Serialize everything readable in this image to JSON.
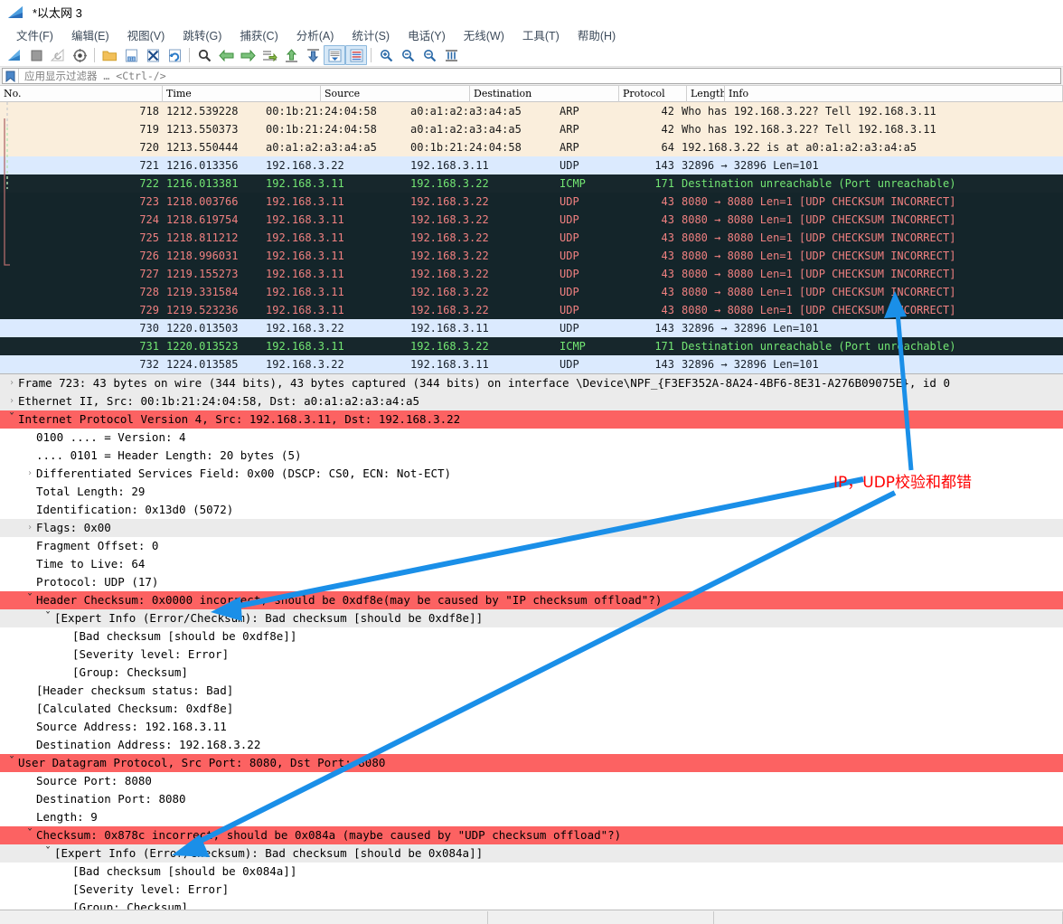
{
  "window": {
    "title": "*以太网 3",
    "logo_icon": "wireshark-shark-fin-icon"
  },
  "menu": {
    "items": [
      {
        "label": "文件(F)",
        "name": "menu-file"
      },
      {
        "label": "编辑(E)",
        "name": "menu-edit"
      },
      {
        "label": "视图(V)",
        "name": "menu-view"
      },
      {
        "label": "跳转(G)",
        "name": "menu-go"
      },
      {
        "label": "捕获(C)",
        "name": "menu-capture"
      },
      {
        "label": "分析(A)",
        "name": "menu-analyze"
      },
      {
        "label": "统计(S)",
        "name": "menu-statistics"
      },
      {
        "label": "电话(Y)",
        "name": "menu-telephony"
      },
      {
        "label": "无线(W)",
        "name": "menu-wireless"
      },
      {
        "label": "工具(T)",
        "name": "menu-tools"
      },
      {
        "label": "帮助(H)",
        "name": "menu-help"
      }
    ]
  },
  "toolbar": {
    "icons": [
      "start-capture-icon",
      "stop-capture-icon",
      "restart-capture-icon",
      "capture-options-icon",
      "open-file-icon",
      "save-file-icon",
      "close-file-icon",
      "reload-file-icon",
      "find-packet-icon",
      "go-back-icon",
      "go-forward-icon",
      "go-to-packet-icon",
      "go-to-first-packet-icon",
      "go-to-last-packet-icon",
      "auto-scroll-icon",
      "colorize-icon",
      "zoom-in-icon",
      "zoom-out-icon",
      "zoom-reset-icon",
      "resize-columns-icon"
    ]
  },
  "filter": {
    "bookmark_icon": "filter-bookmark-icon",
    "placeholder": "应用显示过滤器 … <Ctrl-/>"
  },
  "packet_list": {
    "columns": [
      "No.",
      "Time",
      "Source",
      "Destination",
      "Protocol",
      "Length",
      "Info"
    ],
    "rows": [
      {
        "no": "718",
        "time": "1212.539228",
        "src": "00:1b:21:24:04:58",
        "dst": "a0:a1:a2:a3:a4:a5",
        "proto": "ARP",
        "len": "42",
        "info": "Who has 192.168.3.22? Tell 192.168.3.11",
        "style": "rs-arp"
      },
      {
        "no": "719",
        "time": "1213.550373",
        "src": "00:1b:21:24:04:58",
        "dst": "a0:a1:a2:a3:a4:a5",
        "proto": "ARP",
        "len": "42",
        "info": "Who has 192.168.3.22? Tell 192.168.3.11",
        "style": "rs-arp"
      },
      {
        "no": "720",
        "time": "1213.550444",
        "src": "a0:a1:a2:a3:a4:a5",
        "dst": "00:1b:21:24:04:58",
        "proto": "ARP",
        "len": "64",
        "info": "192.168.3.22 is at a0:a1:a2:a3:a4:a5",
        "style": "rs-arp"
      },
      {
        "no": "721",
        "time": "1216.013356",
        "src": "192.168.3.22",
        "dst": "192.168.3.11",
        "proto": "UDP",
        "len": "143",
        "info": "32896 → 32896 Len=101",
        "style": "rs-udp"
      },
      {
        "no": "722",
        "time": "1216.013381",
        "src": "192.168.3.11",
        "dst": "192.168.3.22",
        "proto": "ICMP",
        "len": "171",
        "info": "Destination unreachable (Port unreachable)",
        "style": "rs-icmp"
      },
      {
        "no": "723",
        "time": "1218.003766",
        "src": "192.168.3.11",
        "dst": "192.168.3.22",
        "proto": "UDP",
        "len": "43",
        "info": "8080 → 8080 Len=1 [UDP CHECKSUM INCORRECT]",
        "style": "rs-bad"
      },
      {
        "no": "724",
        "time": "1218.619754",
        "src": "192.168.3.11",
        "dst": "192.168.3.22",
        "proto": "UDP",
        "len": "43",
        "info": "8080 → 8080 Len=1 [UDP CHECKSUM INCORRECT]",
        "style": "rs-bad"
      },
      {
        "no": "725",
        "time": "1218.811212",
        "src": "192.168.3.11",
        "dst": "192.168.3.22",
        "proto": "UDP",
        "len": "43",
        "info": "8080 → 8080 Len=1 [UDP CHECKSUM INCORRECT]",
        "style": "rs-bad"
      },
      {
        "no": "726",
        "time": "1218.996031",
        "src": "192.168.3.11",
        "dst": "192.168.3.22",
        "proto": "UDP",
        "len": "43",
        "info": "8080 → 8080 Len=1 [UDP CHECKSUM INCORRECT]",
        "style": "rs-bad"
      },
      {
        "no": "727",
        "time": "1219.155273",
        "src": "192.168.3.11",
        "dst": "192.168.3.22",
        "proto": "UDP",
        "len": "43",
        "info": "8080 → 8080 Len=1 [UDP CHECKSUM INCORRECT]",
        "style": "rs-bad"
      },
      {
        "no": "728",
        "time": "1219.331584",
        "src": "192.168.3.11",
        "dst": "192.168.3.22",
        "proto": "UDP",
        "len": "43",
        "info": "8080 → 8080 Len=1 [UDP CHECKSUM INCORRECT]",
        "style": "rs-bad"
      },
      {
        "no": "729",
        "time": "1219.523236",
        "src": "192.168.3.11",
        "dst": "192.168.3.22",
        "proto": "UDP",
        "len": "43",
        "info": "8080 → 8080 Len=1 [UDP CHECKSUM INCORRECT]",
        "style": "rs-bad"
      },
      {
        "no": "730",
        "time": "1220.013503",
        "src": "192.168.3.22",
        "dst": "192.168.3.11",
        "proto": "UDP",
        "len": "143",
        "info": "32896 → 32896 Len=101",
        "style": "rs-udp"
      },
      {
        "no": "731",
        "time": "1220.013523",
        "src": "192.168.3.11",
        "dst": "192.168.3.22",
        "proto": "ICMP",
        "len": "171",
        "info": "Destination unreachable (Port unreachable)",
        "style": "rs-icmp"
      },
      {
        "no": "732",
        "time": "1224.013585",
        "src": "192.168.3.22",
        "dst": "192.168.3.11",
        "proto": "UDP",
        "len": "143",
        "info": "32896 → 32896 Len=101",
        "style": "rs-udp"
      }
    ]
  },
  "packet_details": {
    "rows": [
      {
        "indent": 0,
        "twisty": "collapsed",
        "text": "Frame 723: 43 bytes on wire (344 bits), 43 bytes captured (344 bits) on interface \\Device\\NPF_{F3EF352A-8A24-4BF6-8E31-A276B09075E}, id 0",
        "style": "d-gray"
      },
      {
        "indent": 0,
        "twisty": "collapsed",
        "text": "Ethernet II, Src: 00:1b:21:24:04:58, Dst: a0:a1:a2:a3:a4:a5",
        "style": "d-gray"
      },
      {
        "indent": 0,
        "twisty": "expanded",
        "text": "Internet Protocol Version 4, Src: 192.168.3.11, Dst: 192.168.3.22",
        "style": "d-red"
      },
      {
        "indent": 1,
        "twisty": "none",
        "text": "0100 .... = Version: 4",
        "style": ""
      },
      {
        "indent": 1,
        "twisty": "none",
        "text": ".... 0101 = Header Length: 20 bytes (5)",
        "style": ""
      },
      {
        "indent": 1,
        "twisty": "collapsed",
        "text": "Differentiated Services Field: 0x00 (DSCP: CS0, ECN: Not-ECT)",
        "style": ""
      },
      {
        "indent": 1,
        "twisty": "none",
        "text": "Total Length: 29",
        "style": ""
      },
      {
        "indent": 1,
        "twisty": "none",
        "text": "Identification: 0x13d0 (5072)",
        "style": ""
      },
      {
        "indent": 1,
        "twisty": "collapsed",
        "text": "Flags: 0x00",
        "style": "d-gray"
      },
      {
        "indent": 1,
        "twisty": "none",
        "text": "Fragment Offset: 0",
        "style": ""
      },
      {
        "indent": 1,
        "twisty": "none",
        "text": "Time to Live: 64",
        "style": ""
      },
      {
        "indent": 1,
        "twisty": "none",
        "text": "Protocol: UDP (17)",
        "style": ""
      },
      {
        "indent": 1,
        "twisty": "expanded",
        "text": "Header Checksum: 0x0000 incorrect, should be 0xdf8e(may be caused by \"IP checksum offload\"?)",
        "style": "d-redfull"
      },
      {
        "indent": 2,
        "twisty": "expanded",
        "text": "[Expert Info (Error/Checksum): Bad checksum [should be 0xdf8e]]",
        "style": "d-gray"
      },
      {
        "indent": 3,
        "twisty": "none",
        "text": "[Bad checksum [should be 0xdf8e]]",
        "style": ""
      },
      {
        "indent": 3,
        "twisty": "none",
        "text": "[Severity level: Error]",
        "style": ""
      },
      {
        "indent": 3,
        "twisty": "none",
        "text": "[Group: Checksum]",
        "style": ""
      },
      {
        "indent": 1,
        "twisty": "none",
        "text": "[Header checksum status: Bad]",
        "style": ""
      },
      {
        "indent": 1,
        "twisty": "none",
        "text": "[Calculated Checksum: 0xdf8e]",
        "style": ""
      },
      {
        "indent": 1,
        "twisty": "none",
        "text": "Source Address: 192.168.3.11",
        "style": ""
      },
      {
        "indent": 1,
        "twisty": "none",
        "text": "Destination Address: 192.168.3.22",
        "style": ""
      },
      {
        "indent": 0,
        "twisty": "expanded",
        "text": "User Datagram Protocol, Src Port: 8080, Dst Port: 8080",
        "style": "d-redfull"
      },
      {
        "indent": 1,
        "twisty": "none",
        "text": "Source Port: 8080",
        "style": ""
      },
      {
        "indent": 1,
        "twisty": "none",
        "text": "Destination Port: 8080",
        "style": ""
      },
      {
        "indent": 1,
        "twisty": "none",
        "text": "Length: 9",
        "style": ""
      },
      {
        "indent": 1,
        "twisty": "expanded",
        "text": "Checksum: 0x878c incorrect, should be 0x084a (maybe caused by \"UDP checksum offload\"?)",
        "style": "d-redfull"
      },
      {
        "indent": 2,
        "twisty": "expanded",
        "text": "[Expert Info (Error/Checksum): Bad checksum [should be 0x084a]]",
        "style": "d-gray"
      },
      {
        "indent": 3,
        "twisty": "none",
        "text": "[Bad checksum [should be 0x084a]]",
        "style": ""
      },
      {
        "indent": 3,
        "twisty": "none",
        "text": "[Severity level: Error]",
        "style": ""
      },
      {
        "indent": 3,
        "twisty": "none",
        "text": "[Group: Checksum]",
        "style": ""
      }
    ]
  },
  "annotation": {
    "text": "IP，UDP校验和都错",
    "color": "#ff0000",
    "arrow_color": "#1a8fe8",
    "arrow_count": 3
  }
}
